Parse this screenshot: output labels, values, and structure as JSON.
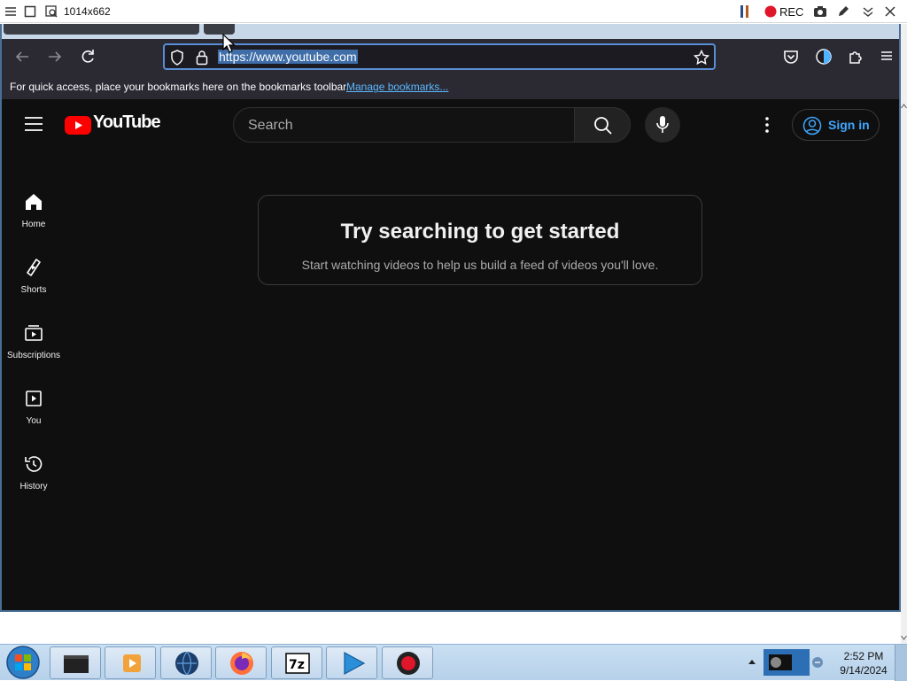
{
  "recorder": {
    "size_text": "1014x662",
    "rec_label": "REC"
  },
  "browser": {
    "url": "https://www.youtube.com",
    "bookmarks_hint": "For quick access, place your bookmarks here on the bookmarks toolbar.",
    "manage_bookmarks": "Manage bookmarks..."
  },
  "youtube": {
    "logo_text": "YouTube",
    "search_placeholder": "Search",
    "sign_in": "Sign in",
    "sidebar": [
      {
        "label": "Home",
        "icon": "home-icon"
      },
      {
        "label": "Shorts",
        "icon": "shorts-icon"
      },
      {
        "label": "Subscriptions",
        "icon": "subscriptions-icon"
      },
      {
        "label": "You",
        "icon": "you-icon"
      },
      {
        "label": "History",
        "icon": "history-icon"
      }
    ],
    "empty_state": {
      "title": "Try searching to get started",
      "subtitle": "Start watching videos to help us build a feed of videos you'll love."
    }
  },
  "taskbar": {
    "time": "2:52 PM",
    "date": "9/14/2024"
  },
  "colors": {
    "yt_red": "#ff0000",
    "link_blue": "#3ea6ff",
    "rec_red": "#e0162b"
  }
}
